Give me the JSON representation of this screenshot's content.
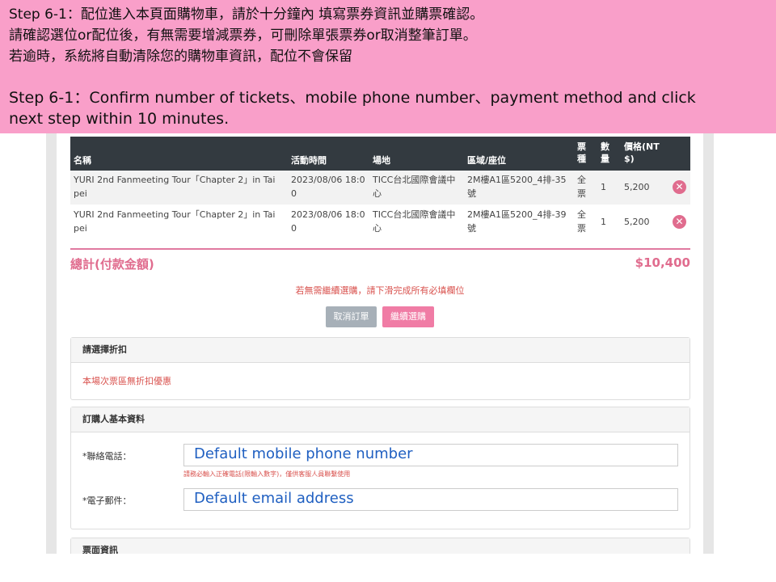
{
  "banner": {
    "lines": [
      "Step 6-1：配位進入本頁面購物車，請於十分鐘內  填寫票券資訊並購票確認。",
      "請確認選位or配位後，有無需要增減票券，可刪除單張票券or取消整筆訂單。",
      "若逾時，系統將自動清除您的購物車資訊，配位不會保留",
      "Step 6-1：Confirm  number of tickets、mobile phone number、payment method and click",
      "next step within 10 minutes."
    ]
  },
  "table": {
    "headers": {
      "name": "名稱",
      "time": "活動時間",
      "venue": "場地",
      "area": "區域/座位",
      "type1": "票",
      "type2": "種",
      "qty1": "數",
      "qty2": "量",
      "price1": "價格(NT",
      "price2": "$)"
    },
    "rows": [
      {
        "name1": "YURI 2nd Fanmeeting Tour「Chapter 2」in Tai",
        "name2": "pei",
        "time1": "2023/08/06 18:0",
        "time2": "0",
        "venue1": "TICC台北國際會議中",
        "venue2": "心",
        "area1": "2M樓A1區5200_4排-35",
        "area2": "號",
        "type1": "全",
        "type2": "票",
        "qty": "1",
        "price": "5,200"
      },
      {
        "name1": "YURI 2nd Fanmeeting Tour「Chapter 2」in Tai",
        "name2": "pei",
        "time1": "2023/08/06 18:0",
        "time2": "0",
        "venue1": "TICC台北國際會議中",
        "venue2": "心",
        "area1": "2M樓A1區5200_4排-39",
        "area2": "號",
        "type1": "全",
        "type2": "票",
        "qty": "1",
        "price": "5,200"
      }
    ]
  },
  "total": {
    "label": "總計(付款金額)",
    "value": "$10,400"
  },
  "notice": "若無需繼續選購，請下滑完成所有必填欄位",
  "buttons": {
    "cancel": "取消訂單",
    "continue": "繼續選購"
  },
  "discount": {
    "title": "請選擇折扣",
    "text": "本場次票區無折扣優惠"
  },
  "buyer": {
    "title": "訂購人基本資料",
    "phone_label": "*聯絡電話：",
    "phone_value": "Default mobile phone number",
    "phone_hint": "請務必輸入正確電話(限輸入數字)，僅供客服人員聯繫使用",
    "email_label": "*電子郵件：",
    "email_value": "Default email address"
  },
  "ticket_info": {
    "title": "票面資訊"
  }
}
